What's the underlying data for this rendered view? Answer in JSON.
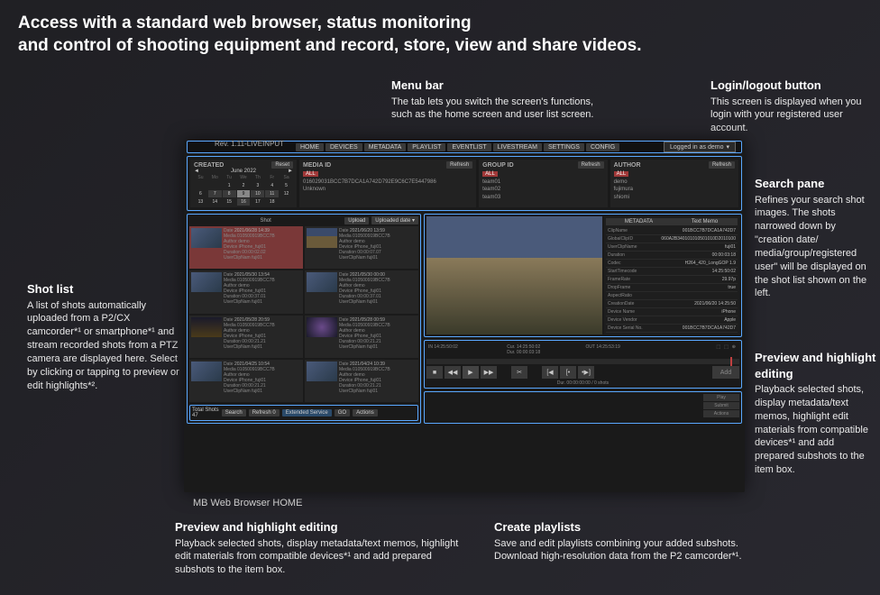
{
  "headline": "Access with a standard web browser, status monitoring\nand control of shooting equipment and record, store, view and share videos.",
  "callouts": {
    "menubar": {
      "title": "Menu bar",
      "body": "The tab lets you switch the screen's functions, such as the home screen and user list screen."
    },
    "login": {
      "title": "Login/logout button",
      "body": "This screen is displayed when you login with your registered user account."
    },
    "searchpane": {
      "title": "Search pane",
      "body": "Refines your search shot images. The shots narrowed down by \"creation date/ media/group/registered user\" will be displayed on the shot list shown on the left."
    },
    "shotlist": {
      "title": "Shot list",
      "body": "A list of shots automatically uploaded from a P2/CX camcorder*¹ or smartphone*¹ and stream recorded shots from a PTZ camera are displayed here. Select by clicking or tapping to preview or edit highlights*²."
    },
    "previewR": {
      "title": "Preview and highlight editing",
      "body": "Playback selected shots, display metadata/text memos, highlight edit materials from compatible devices*¹ and add prepared subshots to the item box."
    },
    "previewB": {
      "title": "Preview and highlight editing",
      "body": "Playback selected shots, display metadata/text memos, highlight edit materials from compatible devices*¹ and add prepared subshots to the item box."
    },
    "playlists": {
      "title": "Create playlists",
      "body": "Save and edit playlists combining your added subshots. Download high-resolution data from the P2 camcorder*¹."
    }
  },
  "app_caption": "MB Web Browser HOME",
  "rev": "Rev. 1.11-LIVEINPUT",
  "menubar": {
    "tabs": [
      "HOME",
      "DEVICES",
      "METADATA",
      "PLAYLIST",
      "EVENTLIST",
      "LIVESTREAM",
      "SETTINGS",
      "CONFIG"
    ],
    "login": "Logged in as demo"
  },
  "search": {
    "created": {
      "label": "CREATED",
      "month": "June 2022",
      "reset": "Reset",
      "days": [
        "Su",
        "Mo",
        "Tu",
        "We",
        "Th",
        "Fr",
        "Sa"
      ],
      "dates": [
        "",
        "",
        "1",
        "2",
        "3",
        "4",
        "5",
        "6",
        "7",
        "8",
        "9",
        "10",
        "11",
        "12",
        "13",
        "14",
        "15",
        "16",
        "17",
        "18"
      ],
      "selected": "9"
    },
    "media": {
      "label": "MEDIA ID",
      "refresh": "Refresh",
      "all": "ALL",
      "items": [
        "016029031BCC7B7DCA1A742D792E9C6C7E5447986",
        "Unknown"
      ]
    },
    "group": {
      "label": "GROUP ID",
      "refresh": "Refresh",
      "all": "ALL",
      "items": [
        "team01",
        "team02",
        "team03"
      ]
    },
    "author": {
      "label": "AUTHOR",
      "refresh": "Refresh",
      "all": "ALL",
      "items": [
        "demo",
        "fujimura",
        "shiomi"
      ]
    }
  },
  "shotlist": {
    "title": "Shot",
    "upload": "Upload",
    "sort": "Uploaded date ▾",
    "shots": [
      {
        "date": "2021/06/28 14:39",
        "media": "010500919BCC7B",
        "author": "demo",
        "device": "iPhone_fuji01",
        "duration": "00:00:02.02",
        "userclip": "fuji01",
        "sel": true,
        "th": "thumb"
      },
      {
        "date": "2021/06/20 13:59",
        "media": "010500919BCC7B",
        "author": "demo",
        "device": "iPhone_fuji01",
        "duration": "00:00:07.07",
        "userclip": "fuji01",
        "th": "thumb stadium"
      },
      {
        "date": "2021/05/30 13:54",
        "media": "010500919BCC7B",
        "author": "demo",
        "device": "iPhone_fuji01",
        "duration": "00:00:37.01",
        "userclip": "fuji01",
        "th": "thumb"
      },
      {
        "date": "2021/05/30 00:00",
        "media": "010500919BCC7B",
        "author": "demo",
        "device": "iPhone_fuji01",
        "duration": "00:00:37.01",
        "userclip": "fuji01",
        "th": "thumb"
      },
      {
        "date": "2021/05/28 20:59",
        "media": "010500919BCC7B",
        "author": "demo",
        "device": "iPhone_fuji01",
        "duration": "00:00:21.21",
        "userclip": "fuji01",
        "th": "thumb night"
      },
      {
        "date": "2021/05/28 00:59",
        "media": "010500919BCC7B",
        "author": "demo",
        "device": "iPhone_fuji01",
        "duration": "00:00:21.21",
        "userclip": "fuji01",
        "th": "thumb concert"
      },
      {
        "date": "2021/04/25 10:54",
        "media": "010500919BCC7B",
        "author": "demo",
        "device": "iPhone_fuji01",
        "duration": "00:00:21.21",
        "userclip": "fuji01",
        "th": "thumb"
      },
      {
        "date": "2021/04/24 10:39",
        "media": "010500919BCC7B",
        "author": "demo",
        "device": "iPhone_fuji01",
        "duration": "00:00:21.21",
        "userclip": "fuji01",
        "th": "thumb"
      }
    ],
    "meta_labels": {
      "date": "Date",
      "media": "Media",
      "author": "Author",
      "device": "Device",
      "duration": "Duration",
      "userclip": "UserClipNam"
    },
    "footer": {
      "total_label": "Total Shots",
      "total": "47",
      "search": "Search",
      "refresh": "Refresh 0",
      "ext": "Extended Service",
      "go": "GO",
      "actions": "Actions"
    }
  },
  "preview": {
    "tabs": [
      "METADATA",
      "Text Memo"
    ],
    "meta": [
      {
        "k": "ClipName",
        "v": "001BCC7B7DCA1A742D7"
      },
      {
        "k": "GlobalClipID",
        "v": "060A2B340101010501010D2010100"
      },
      {
        "k": "UserClipName",
        "v": "fuji01"
      },
      {
        "k": "Duration",
        "v": "00:00:03:18"
      },
      {
        "k": "Codec",
        "v": "H264_420_LongGOP 1.9"
      },
      {
        "k": "StartTimecode",
        "v": "14:25:50:02"
      },
      {
        "k": "FrameRate",
        "v": "29.97p"
      },
      {
        "k": "DropFrame",
        "v": "true"
      },
      {
        "k": "AspectRatio",
        "v": ""
      },
      {
        "k": "CreationDate",
        "v": "2021/06/20 14:25:50"
      },
      {
        "k": "Device Name",
        "v": "iPhone"
      },
      {
        "k": "Device Vendor",
        "v": "Apple"
      },
      {
        "k": "Device Serial No.",
        "v": "001BCC7B7DCA1A742D7"
      }
    ],
    "tc": {
      "in_l": "IN",
      "in": "14:25:50:02",
      "cur_l": "Cur.",
      "cur": "14:25:50:02",
      "dur_l": "Dur.",
      "dur": "00:00:03:18",
      "out_l": "OUT",
      "out": "14:25:53:19"
    },
    "icons": [
      "⬚",
      "⬚",
      "⊕"
    ],
    "controls": [
      "■",
      "◀◀",
      "▶",
      "▶▶",
      "✂",
      "[◀",
      "[•",
      "•▶]",
      "Add"
    ],
    "dur_txt": "Dur. 00:00:00:00 / 0 shots"
  },
  "itembox": {
    "btns": [
      "Play",
      "Submit",
      "Actions"
    ]
  }
}
